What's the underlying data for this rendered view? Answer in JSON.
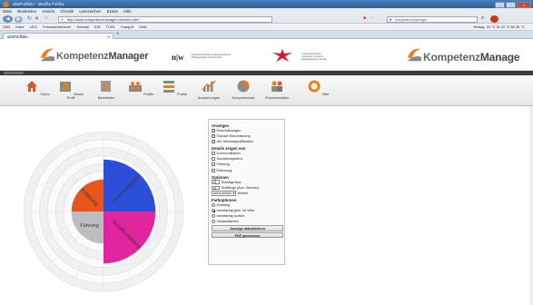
{
  "browser": {
    "title": "ubsPortfolio - Mozilla Firefox",
    "window_buttons": [
      "–",
      "▫",
      "x"
    ],
    "menu": [
      "Datei",
      "Bearbeiten",
      "Ansicht",
      "Chronik",
      "Lesezeichen",
      "Extras",
      "Hilfe"
    ],
    "url": "http://www.kompetenzmanager.ch/index.cfm?",
    "search_placeholder": "kompetenzmanager",
    "bookmarks": [
      "SBB",
      "Karte",
      "LEO",
      "Fremdwörterbuch",
      "Hotmail",
      "EIS",
      "TURL",
      "Fawg.ilt",
      "Gekl"
    ],
    "status": "Wolkig, 19 °C   Di 23 °C   Mi 26 °C",
    "tab_title": "ubsPortfolio"
  },
  "header": {
    "logo_part1": "Kompetenz",
    "logo_part2": "Manager",
    "nw_logo": "n|w",
    "fhnw_text": [
      "Fachhochschule Nordwestschweiz",
      "Pädagogische Hochschule"
    ],
    "uzh_text": [
      "Universität Zürich",
      "University of Zurich",
      "Pädagogisches Institut"
    ],
    "right_logo_part1": "Kompetenz",
    "right_logo_part2": "Manage"
  },
  "toolbar": [
    {
      "label": "Home",
      "icon": "home-icon"
    },
    {
      "label": "Neues Profil",
      "icon": "new-profile-icon"
    },
    {
      "label": "Bearbeiten",
      "icon": "edit-icon"
    },
    {
      "label": "Profile",
      "icon": "profiles-icon"
    },
    {
      "label": "Profile",
      "icon": "profiles-compare-icon"
    },
    {
      "label": "Auswertungen",
      "icon": "chart-icon"
    },
    {
      "label": "Kompetenzrad",
      "icon": "pie-icon"
    },
    {
      "label": "Personendaten",
      "icon": "people-icon"
    },
    {
      "label": "Hilfe",
      "icon": "help-icon"
    }
  ],
  "wheel": {
    "segments": [
      {
        "label": "Kommunikation",
        "color": "#2b4fd8",
        "value": 0.65
      },
      {
        "label": "Sozialkompetenz",
        "color": "#e2249e",
        "value": 0.65
      },
      {
        "label": "Führung",
        "color": "#bdbdbd",
        "value": 0.4
      },
      {
        "label": "Erfahrung",
        "color": "#e8561c",
        "value": 0.4
      }
    ]
  },
  "panel": {
    "anzeigen_title": "Anzeigen",
    "anzeigen": [
      {
        "label": "Einschätzungen",
        "checked": true
      },
      {
        "label": "Globale Einschätzung",
        "checked": true
      },
      {
        "label": "def. Minimalqualifikation",
        "checked": true
      }
    ],
    "details_title": "Details zeigen von",
    "details": [
      {
        "label": "Kommunikation",
        "checked": false
      },
      {
        "label": "Sozialkompetenz",
        "checked": false
      },
      {
        "label": "Führung",
        "checked": false
      },
      {
        "label": "Erfahrung",
        "checked": false
      }
    ],
    "optionen_title": "Optionen",
    "font_size": "15",
    "font_size_label": "Schriftgrösse",
    "text_length": "25",
    "text_length_label": "Textlänge (Anz. Zeichen)",
    "angle_value": "automatisch",
    "angle_label": "Winkel",
    "farb_title": "Farboptionen",
    "farb": [
      {
        "label": "einfarbig",
        "on": false
      },
      {
        "label": "mehrfarbig gem. Ist Wert",
        "on": true
      },
      {
        "label": "mehrfarbig sortiert",
        "on": false
      },
      {
        "label": "Verlaufsfarben",
        "on": false
      }
    ],
    "update_button": "Anzeige aktualisieren",
    "pdf_button": "PDF generieren"
  }
}
